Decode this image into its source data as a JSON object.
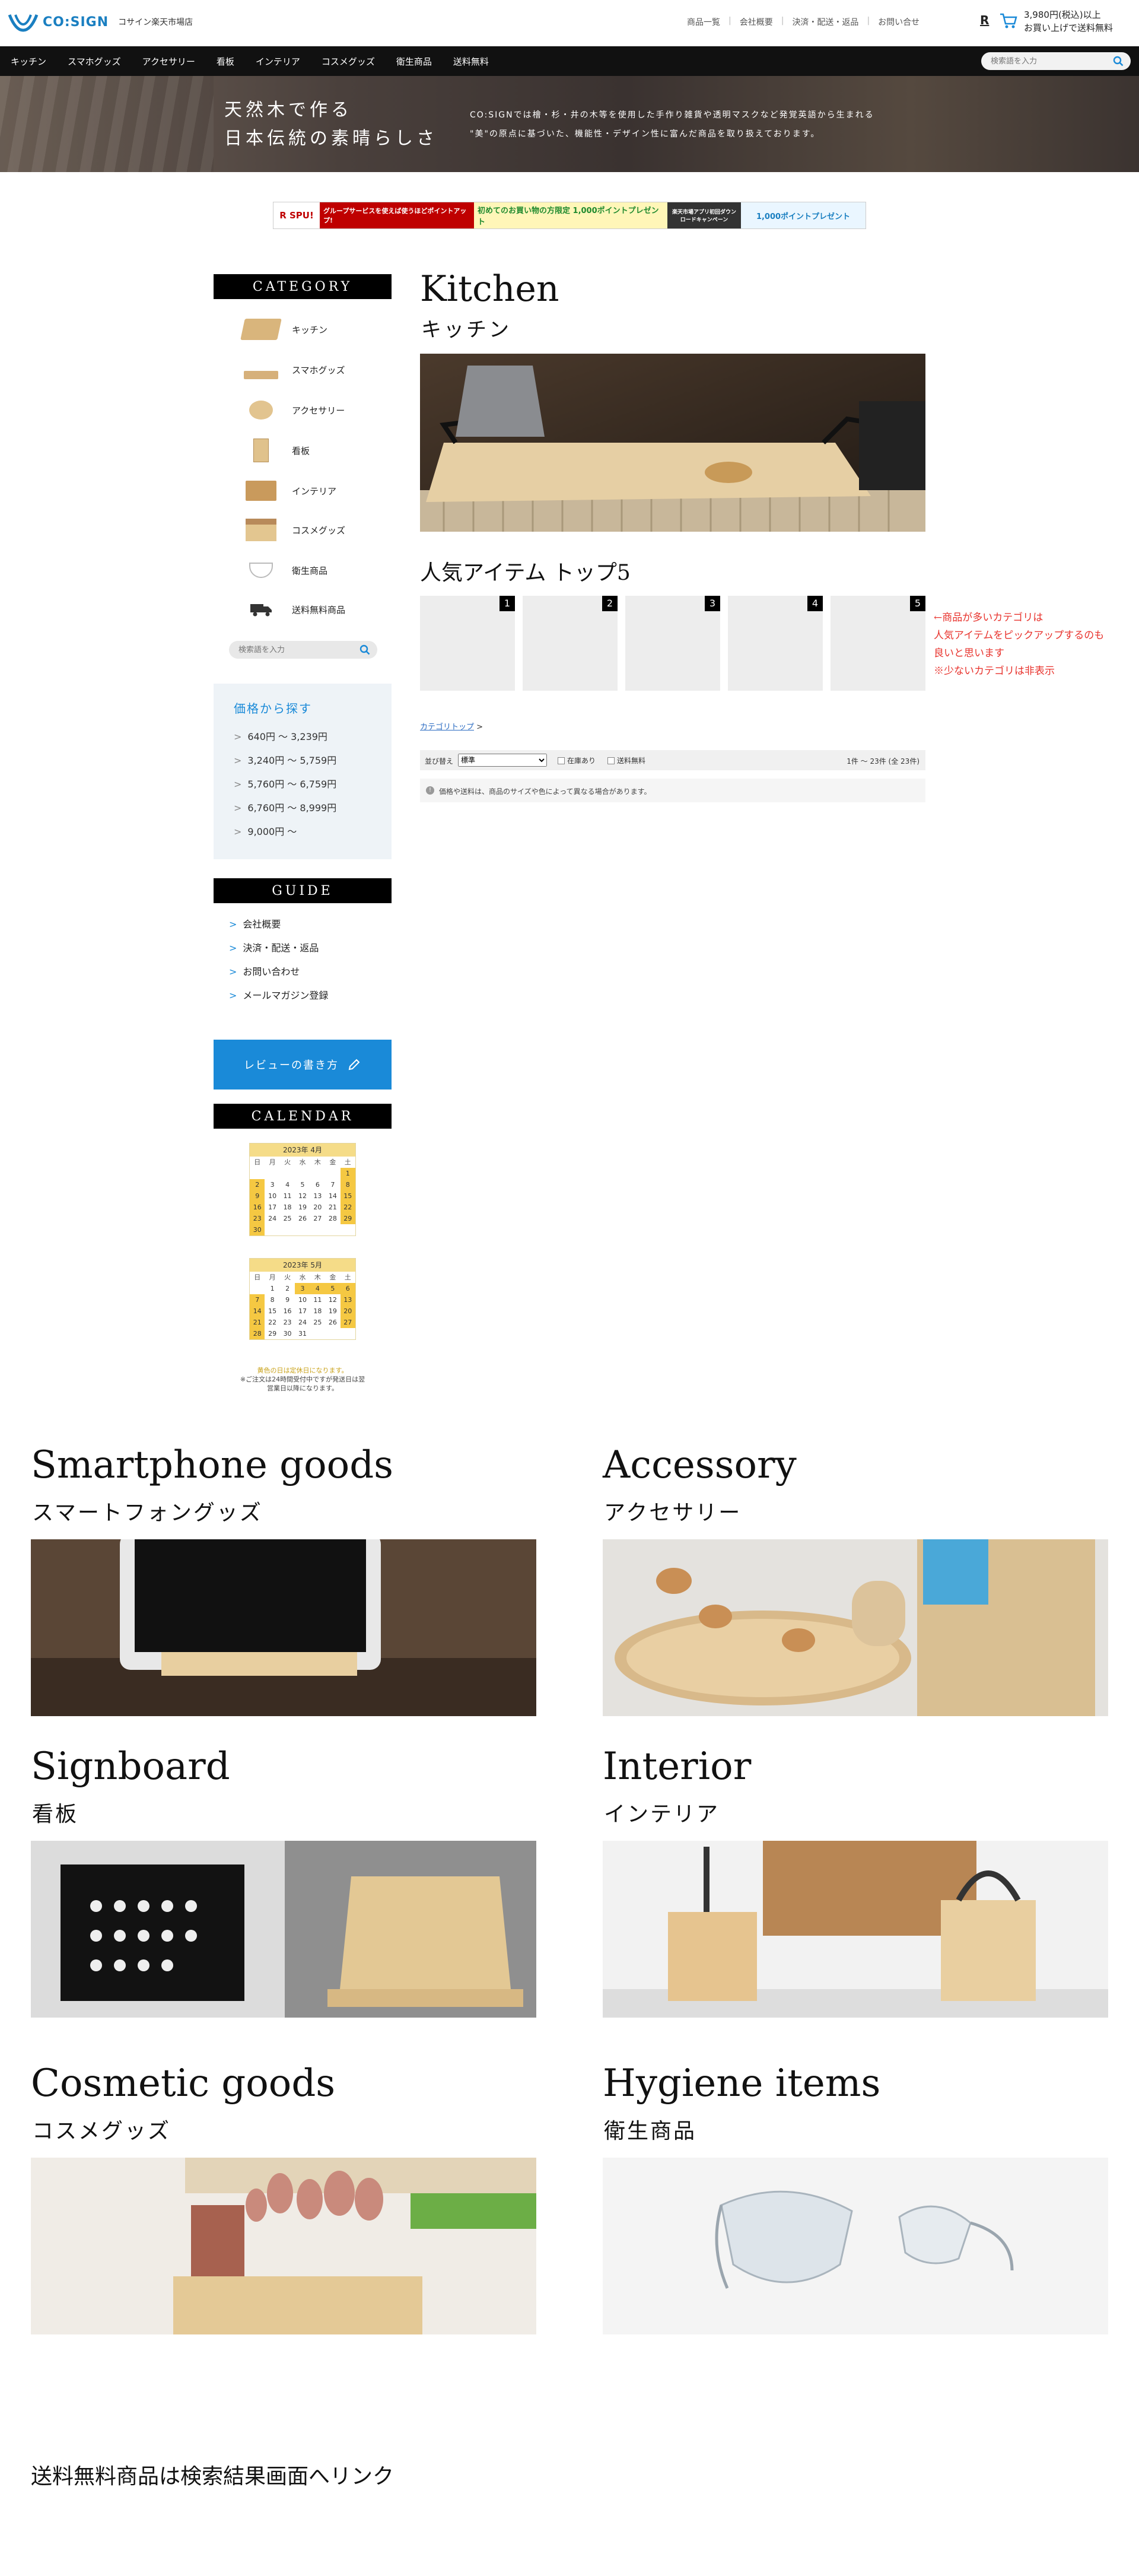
{
  "header": {
    "logo_text": "CO:SIGN",
    "store_name": "コサイン楽天市場店",
    "util_links": [
      "商品一覧",
      "会社概要",
      "決済・配送・返品",
      "お問い合せ"
    ],
    "rakuten_mark": "R",
    "free_shipping_line1": "3,980円(税込)以上",
    "free_shipping_line2": "お買い上げで送料無料"
  },
  "nav": {
    "items": [
      "キッチン",
      "スマホグッズ",
      "アクセサリー",
      "看板",
      "インテリア",
      "コスメグッズ",
      "衛生商品",
      "送料無料"
    ],
    "search_placeholder": "検索語を入力"
  },
  "hero": {
    "title_line1": "天然木で作る",
    "title_line2": "日本伝統の素晴らしさ",
    "text_line1": "CO:SIGNでは檜・杉・井の木等を使用した手作り雑貨や透明マスクなど発覚英語から生まれる",
    "text_line2": "\"美\"の原点に基づいた、機能性・デザイン性に富んだ商品を取り扱えております。"
  },
  "banner": {
    "seg1": "R SPU!",
    "seg2": "グループサービスを使えば使うほどポイントアップ!",
    "seg3": "初めてのお買い物の方限定 1,000ポイントプレゼント",
    "seg4": "楽天市場アプリ初回ダウンロードキャンペーン",
    "seg5": "1,000ポイントプレゼント"
  },
  "sidebar": {
    "category_heading": "CATEGORY",
    "categories": [
      "キッチン",
      "スマホグッズ",
      "アクセサリー",
      "看板",
      "インテリア",
      "コスメグッズ",
      "衛生商品",
      "送料無料商品"
    ],
    "search_placeholder": "検索語を入力",
    "price_title": "価格から探す",
    "price_ranges": [
      "640円 〜 3,239円",
      "3,240円 〜 5,759円",
      "5,760円 〜 6,759円",
      "6,760円 〜 8,999円",
      "9,000円 〜"
    ],
    "guide_heading": "GUIDE",
    "guide_links": [
      "会社概要",
      "決済・配送・返品",
      "お問い合わせ",
      "メールマガジン登録"
    ],
    "review_button": "レビューの書き方",
    "calendar_heading": "CALENDAR",
    "calendar": [
      {
        "title": "2023年 4月",
        "weekdays": [
          "日",
          "月",
          "火",
          "水",
          "木",
          "金",
          "土"
        ],
        "cells": [
          "",
          "",
          "",
          "",
          "",
          "",
          "1",
          "2",
          "3",
          "4",
          "5",
          "6",
          "7",
          "8",
          "9",
          "10",
          "11",
          "12",
          "13",
          "14",
          "15",
          "16",
          "17",
          "18",
          "19",
          "20",
          "21",
          "22",
          "23",
          "24",
          "25",
          "26",
          "27",
          "28",
          "29",
          "30",
          "",
          "",
          "",
          "",
          "",
          ""
        ],
        "off": [
          6,
          7,
          13,
          14,
          20,
          21,
          27,
          28,
          34,
          35
        ]
      },
      {
        "title": "2023年 5月",
        "weekdays": [
          "日",
          "月",
          "火",
          "水",
          "木",
          "金",
          "土"
        ],
        "cells": [
          "",
          "1",
          "2",
          "3",
          "4",
          "5",
          "6",
          "7",
          "8",
          "9",
          "10",
          "11",
          "12",
          "13",
          "14",
          "15",
          "16",
          "17",
          "18",
          "19",
          "20",
          "21",
          "22",
          "23",
          "24",
          "25",
          "26",
          "27",
          "28",
          "29",
          "30",
          "31",
          "",
          "",
          ""
        ],
        "off": [
          3,
          4,
          5,
          6,
          7,
          13,
          14,
          20,
          21,
          27,
          28
        ]
      }
    ],
    "calendar_note_1": "黄色の日は定休日になります。",
    "calendar_note_2": "※ご注文は24時間受付中ですが発送日は翌営業日以降になります。"
  },
  "main": {
    "heading_en": "Kitchen",
    "heading_ja": "キッチン",
    "top5_title": "人気アイテム トップ5",
    "ranks": [
      "1",
      "2",
      "3",
      "4",
      "5"
    ],
    "note_line1": "←商品が多いカテゴリは",
    "note_line2": "人気アイテムをピックアップするのも",
    "note_line3": "良いと思います",
    "note_line4": "※少ないカテゴリは非表示",
    "breadcrumb_link": "カテゴリトップ",
    "breadcrumb_sep": ">",
    "sort_label": "並び替え",
    "sort_value": "標準",
    "filter_stock": "在庫あり",
    "filter_free": "送料無料",
    "result_count": "1件 〜 23件 (全 23件)",
    "notice": "価格や送料は、商品のサイズや色によって異なる場合があります。"
  },
  "sections": [
    {
      "en": "Smartphone goods",
      "ja": "スマートフォングッズ"
    },
    {
      "en": "Accessory",
      "ja": "アクセサリー"
    },
    {
      "en": "Signboard",
      "ja": "看板"
    },
    {
      "en": "Interior",
      "ja": "インテリア"
    },
    {
      "en": "Cosmetic goods",
      "ja": "コスメグッズ"
    },
    {
      "en": "Hygiene items",
      "ja": "衛生商品"
    }
  ],
  "footer_link": "送料無料商品は検索結果画面へリンク",
  "colors": {
    "accent_blue": "#1a8ad8",
    "nav_black": "#111111",
    "note_red": "#e8332d",
    "calendar_off": "#f5c842"
  }
}
